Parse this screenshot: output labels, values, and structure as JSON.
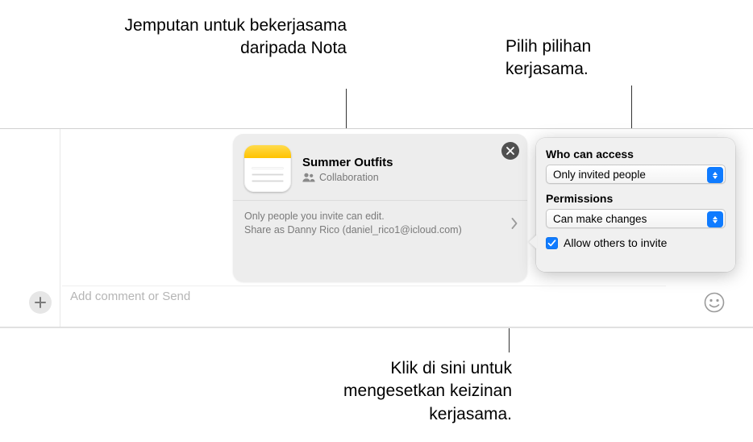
{
  "labels": {
    "top_left": "Jemputan untuk bekerjasama daripada Nota",
    "top_right": "Pilih pilihan kerjasama.",
    "bottom": "Klik di sini untuk mengesetkan keizinan kerjasama."
  },
  "card": {
    "title": "Summer Outfits",
    "subtitle": "Collaboration",
    "edit_info": "Only people you invite can edit.",
    "share_as": "Share as Danny Rico (daniel_rico1@icloud.com)"
  },
  "popover": {
    "access_label": "Who can access",
    "access_value": "Only invited people",
    "permissions_label": "Permissions",
    "permissions_value": "Can make changes",
    "allow_invite_label": "Allow others to invite",
    "allow_invite_checked": true
  },
  "compose": {
    "placeholder": "Add comment or Send"
  }
}
